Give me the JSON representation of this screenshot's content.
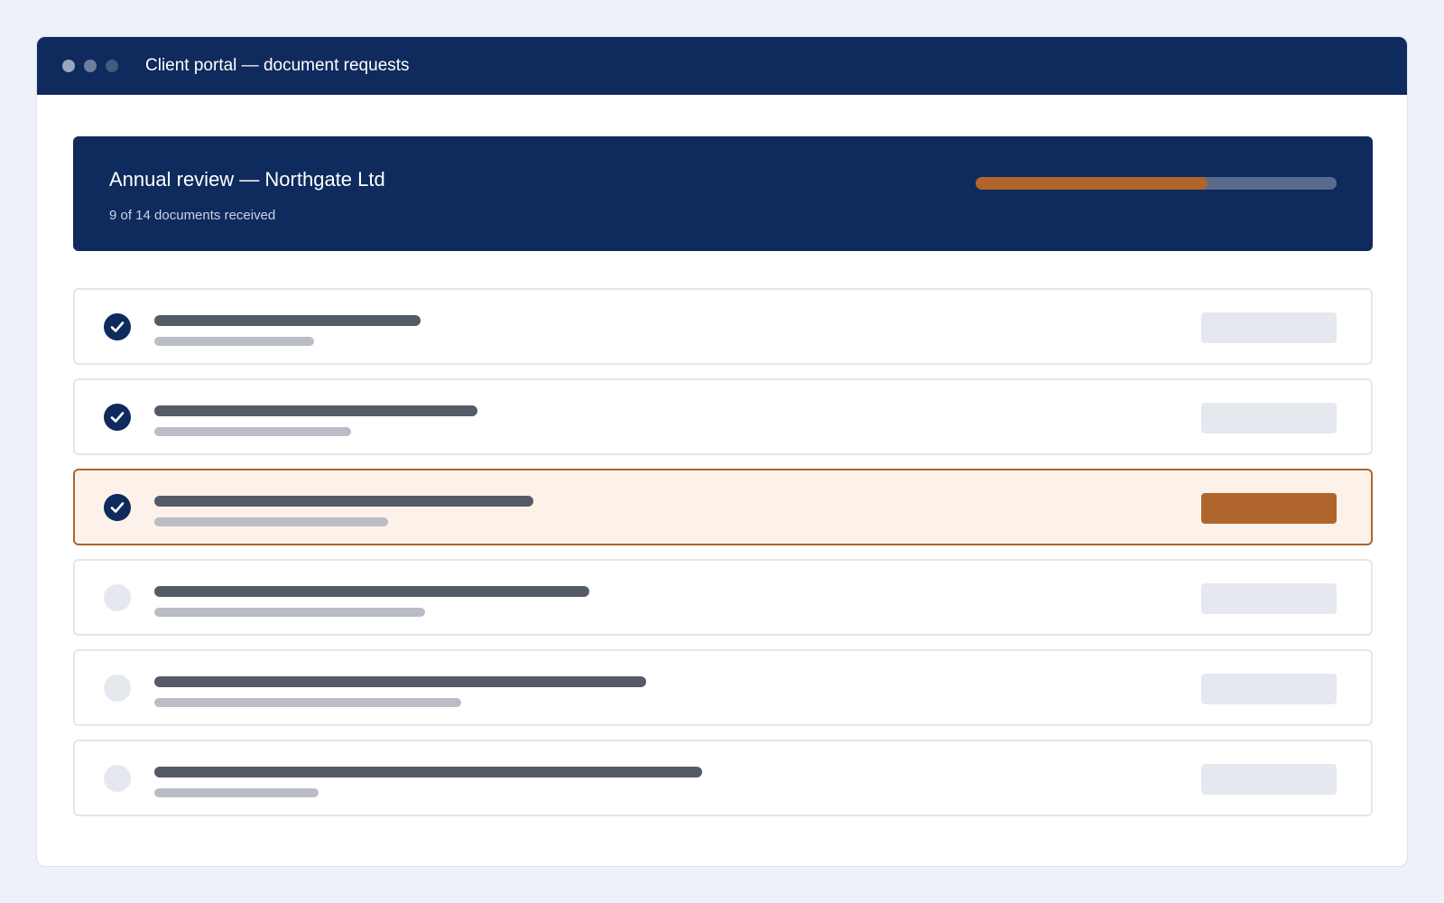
{
  "window": {
    "title": "Client portal — document requests"
  },
  "banner": {
    "title": "Annual review — Northgate Ltd",
    "subtitle": "9 of 14 documents received",
    "progress_fraction": 0.643
  },
  "colors": {
    "brand_navy": "#0f2a5c",
    "accent": "#b0652c",
    "active_row_bg": "#fdf2ea",
    "pending": "#e5e8ef"
  },
  "requests": [
    {
      "status": "received",
      "active": false,
      "status_icon": "check-icon"
    },
    {
      "status": "received",
      "active": false,
      "status_icon": "check-icon"
    },
    {
      "status": "received",
      "active": true,
      "status_icon": "check-icon"
    },
    {
      "status": "pending",
      "active": false,
      "status_icon": "empty-circle-icon"
    },
    {
      "status": "pending",
      "active": false,
      "status_icon": "empty-circle-icon"
    },
    {
      "status": "pending",
      "active": false,
      "status_icon": "empty-circle-icon"
    }
  ]
}
